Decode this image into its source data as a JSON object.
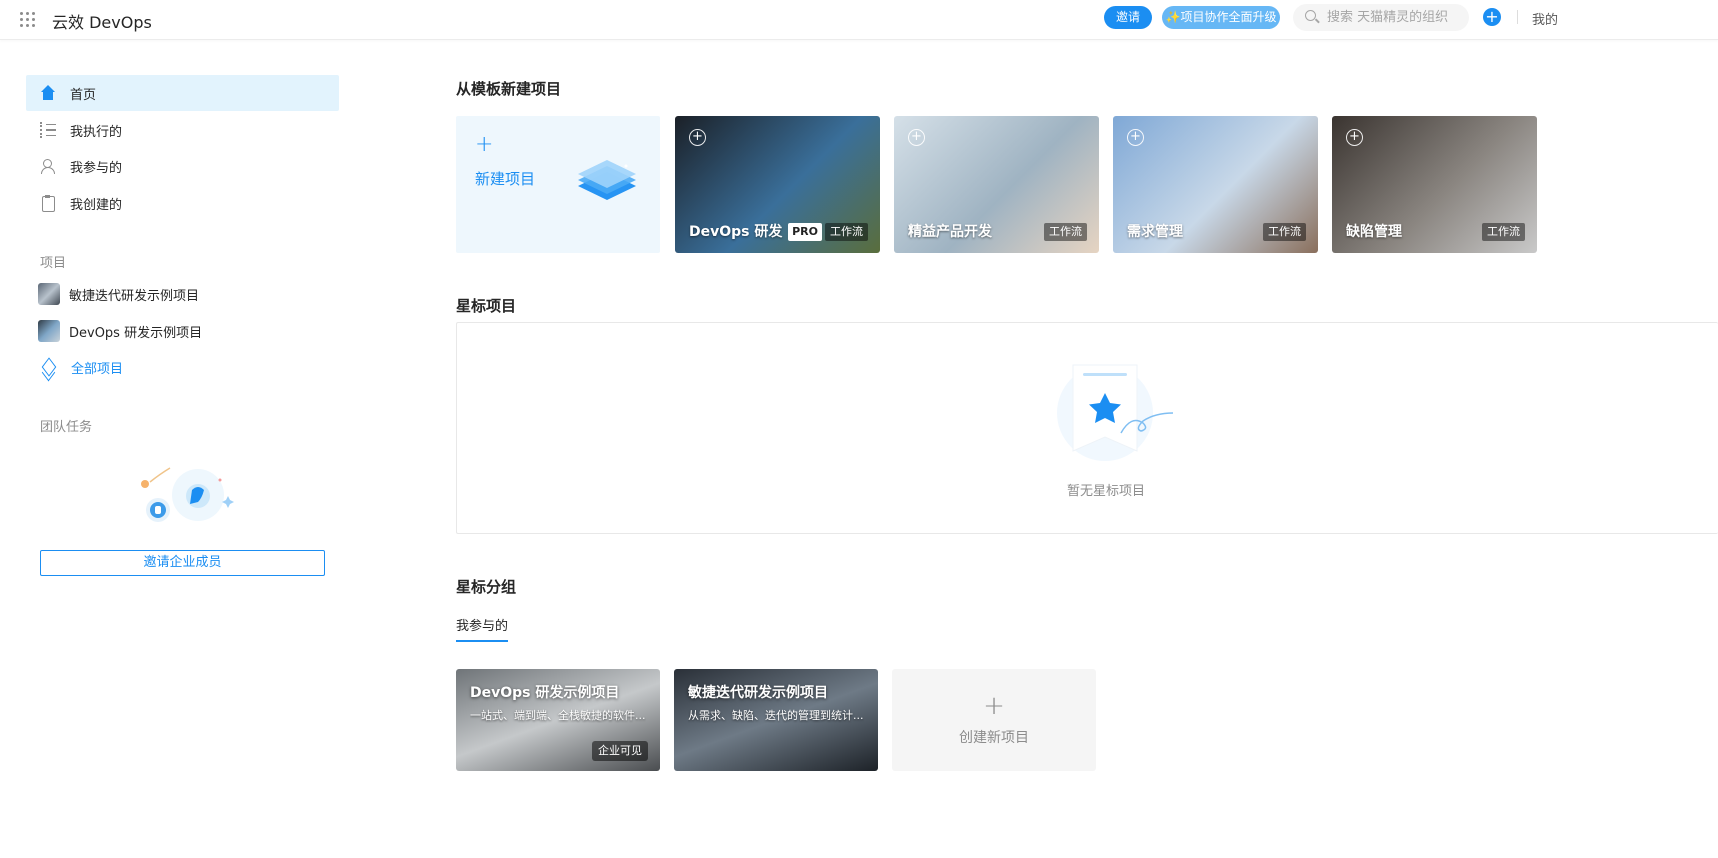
{
  "app": {
    "brand": "云效 DevOps"
  },
  "header": {
    "invite_label": "邀请",
    "upgrade_label": "✨项目协作全面升级",
    "search_placeholder": "搜索 天猫精灵的组织",
    "mine_label": "我的"
  },
  "sidebar": {
    "nav": [
      {
        "label": "首页",
        "icon": "home-icon",
        "active": true
      },
      {
        "label": "我执行的",
        "icon": "checklist-icon"
      },
      {
        "label": "我参与的",
        "icon": "user-icon"
      },
      {
        "label": "我创建的",
        "icon": "clipboard-icon"
      }
    ],
    "projects_label": "项目",
    "projects": [
      {
        "label": "敏捷迭代研发示例项目"
      },
      {
        "label": "DevOps 研发示例项目"
      }
    ],
    "all_projects_label": "全部项目",
    "team_tasks_label": "团队任务",
    "invite_members_label": "邀请企业成员"
  },
  "main": {
    "templates_title": "从模板新建项目",
    "new_project_label": "新建项目",
    "templates": [
      {
        "name": "DevOps 研发",
        "badge": "PRO",
        "tag": "工作流",
        "colors": [
          "#1b2027",
          "#3a6f9a",
          "#5a6e3c"
        ]
      },
      {
        "name": "精益产品开发",
        "tag": "工作流",
        "colors": [
          "#d5e0e8",
          "#9fb3c2",
          "#e6d4c2"
        ]
      },
      {
        "name": "需求管理",
        "tag": "工作流",
        "colors": [
          "#7fa8d6",
          "#c8d8e8",
          "#8a6f5c"
        ]
      },
      {
        "name": "缺陷管理",
        "tag": "工作流",
        "colors": [
          "#3a3430",
          "#8a8580",
          "#c9c9c9"
        ]
      }
    ],
    "starred_title": "星标项目",
    "starred_empty": "暂无星标项目",
    "groups_title": "星标分组",
    "groups_tab": "我参与的",
    "group_cards": [
      {
        "title": "DevOps 研发示例项目",
        "desc": "一站式、端到端、全栈敏捷的软件...",
        "visibility": "企业可见",
        "colors": [
          "#6f7478",
          "#c5c8ca",
          "#4a4d50"
        ]
      },
      {
        "title": "敏捷迭代研发示例项目",
        "desc": "从需求、缺陷、迭代的管理到统计...",
        "colors": [
          "#2a3038",
          "#6e7a86",
          "#1d2228"
        ]
      }
    ],
    "create_new_label": "创建新项目"
  }
}
